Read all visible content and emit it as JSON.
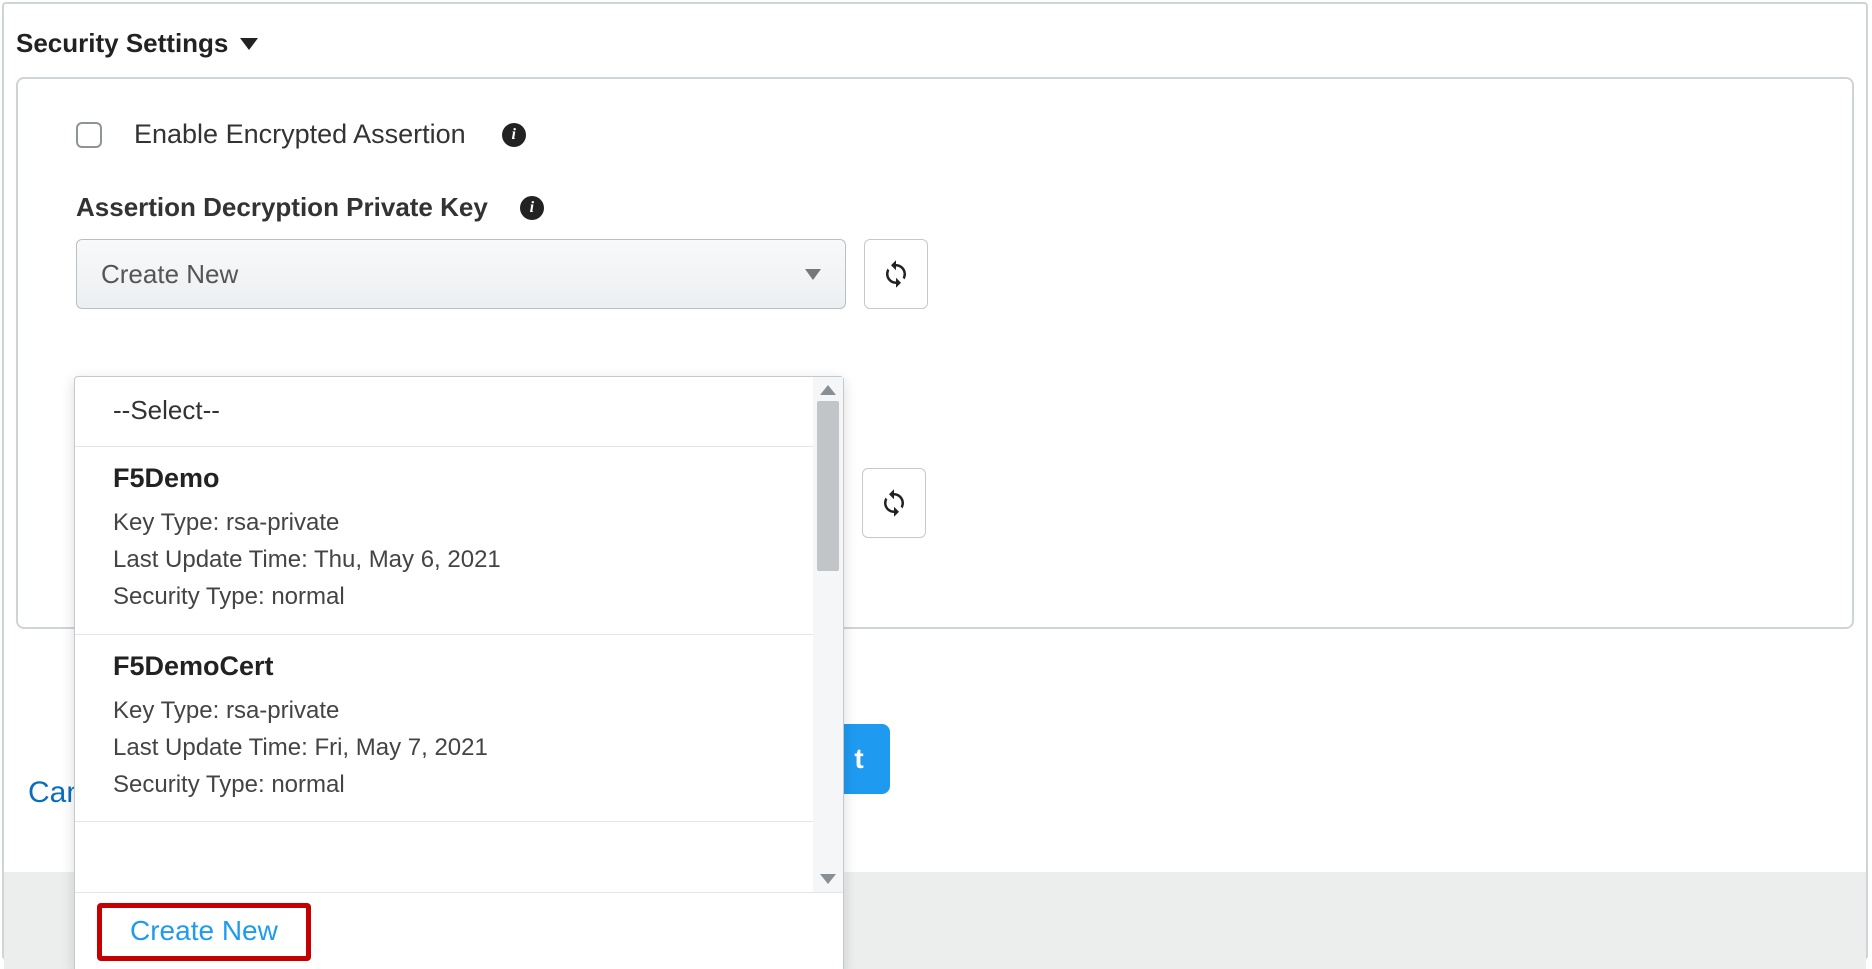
{
  "section": {
    "title": "Security Settings"
  },
  "encrypted": {
    "label": "Enable Encrypted Assertion",
    "checked": false
  },
  "field": {
    "label": "Assertion Decryption Private Key"
  },
  "select": {
    "value": "Create New"
  },
  "dropdown": {
    "placeholder": "--Select--",
    "items": [
      {
        "name": "F5Demo",
        "key_type_label": "Key Type:",
        "key_type": "rsa-private",
        "update_label": "Last Update Time:",
        "update": "Thu, May 6, 2021",
        "sec_label": "Security Type:",
        "sec": "normal"
      },
      {
        "name": "F5DemoCert",
        "key_type_label": "Key Type:",
        "key_type": "rsa-private",
        "update_label": "Last Update Time:",
        "update": "Fri, May 7, 2021",
        "sec_label": "Security Type:",
        "sec": "normal"
      }
    ],
    "create_new": "Create New"
  },
  "footer": {
    "cancel": "Can",
    "next": "t"
  }
}
